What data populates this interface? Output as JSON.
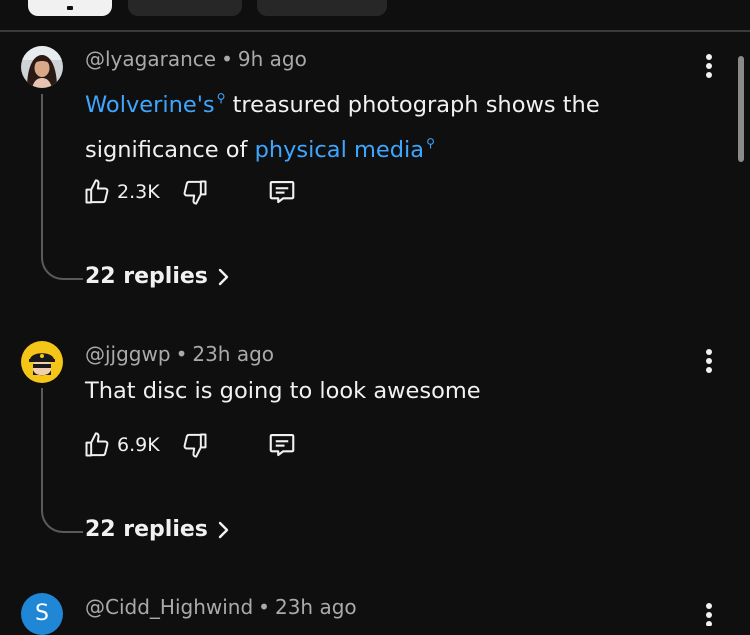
{
  "comments": [
    {
      "handle": "@lyagarance",
      "time": "9h ago",
      "text_parts": [
        "Wolverine's",
        " treasured photograph shows the",
        "significance of ",
        "physical media"
      ],
      "likes": "2.3K",
      "replies": "22 replies"
    },
    {
      "handle": "@jjggwp",
      "time": "23h ago",
      "text": "That disc is going to look awesome",
      "likes": "6.9K",
      "replies": "22 replies"
    },
    {
      "handle": "@Cidd_Highwind",
      "time": "23h ago",
      "avatar_letter": "S"
    }
  ],
  "meta_separator": "•",
  "colors": {
    "background": "#0f0f0f",
    "link": "#3ea6ff",
    "secondary_text": "#aaaaaa",
    "avatar_s": "#1f87d6"
  },
  "icons": [
    "search-icon",
    "thumbs-up-icon",
    "thumbs-down-icon",
    "reply-comment-icon",
    "chevron-right-icon",
    "more-vertical-icon"
  ]
}
